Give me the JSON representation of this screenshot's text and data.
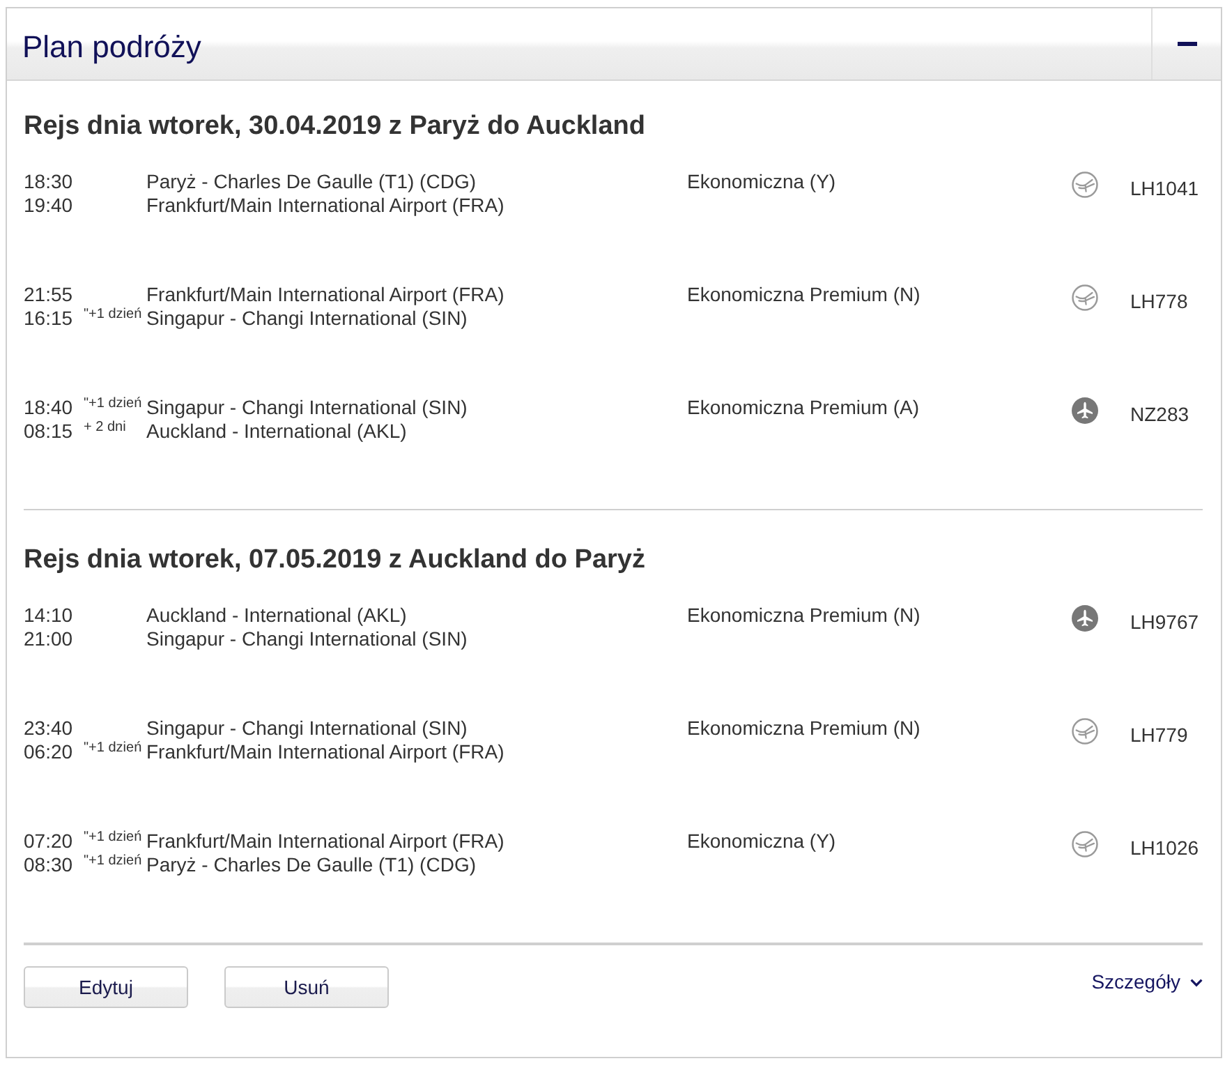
{
  "panel": {
    "title": "Plan podróży",
    "expanded": true
  },
  "journeys": [
    {
      "heading": "Rejs dnia wtorek, 30.04.2019 z Paryż do Auckland",
      "segments": [
        {
          "kind": "bird",
          "departure": {
            "time": "18:30",
            "airport": "Paryż - Charles De Gaulle (T1) (CDG)"
          },
          "arrival": {
            "time": "19:40",
            "airport": "Frankfurt/Main International Airport (FRA)"
          },
          "cabin": "Ekonomiczna (Y)",
          "flight": "LH1041"
        },
        {
          "kind": "bird",
          "departure": {
            "time": "21:55",
            "airport": "Frankfurt/Main International Airport (FRA)"
          },
          "arrival": {
            "time": "16:15",
            "day_offset": "\"+1 dzień",
            "airport": "Singapur - Changi International (SIN)"
          },
          "cabin": "Ekonomiczna Premium (N)",
          "flight": "LH778"
        },
        {
          "kind": "plane",
          "departure": {
            "time": "18:40",
            "day_offset": "\"+1 dzień",
            "airport": "Singapur - Changi International (SIN)"
          },
          "arrival": {
            "time": "08:15",
            "day_offset": "+ 2 dni",
            "airport": "Auckland - International (AKL)"
          },
          "cabin": "Ekonomiczna Premium (A)",
          "flight": "NZ283"
        }
      ]
    },
    {
      "heading": "Rejs dnia wtorek, 07.05.2019 z Auckland do Paryż",
      "segments": [
        {
          "kind": "plane",
          "departure": {
            "time": "14:10",
            "airport": "Auckland - International (AKL)"
          },
          "arrival": {
            "time": "21:00",
            "airport": "Singapur - Changi International (SIN)"
          },
          "cabin": "Ekonomiczna Premium (N)",
          "flight": "LH9767"
        },
        {
          "kind": "bird",
          "departure": {
            "time": "23:40",
            "airport": "Singapur - Changi International (SIN)"
          },
          "arrival": {
            "time": "06:20",
            "day_offset": "\"+1 dzień",
            "airport": "Frankfurt/Main International Airport (FRA)"
          },
          "cabin": "Ekonomiczna Premium (N)",
          "flight": "LH779"
        },
        {
          "kind": "bird",
          "departure": {
            "time": "07:20",
            "day_offset": "\"+1 dzień",
            "airport": "Frankfurt/Main International Airport (FRA)"
          },
          "arrival": {
            "time": "08:30",
            "day_offset": "\"+1 dzień",
            "airport": "Paryż - Charles De Gaulle (T1) (CDG)"
          },
          "cabin": "Ekonomiczna (Y)",
          "flight": "LH1026"
        }
      ]
    }
  ],
  "actions": {
    "buttons": [
      "Edytuj",
      "Usuń"
    ],
    "details_link": "Szczegóły"
  }
}
